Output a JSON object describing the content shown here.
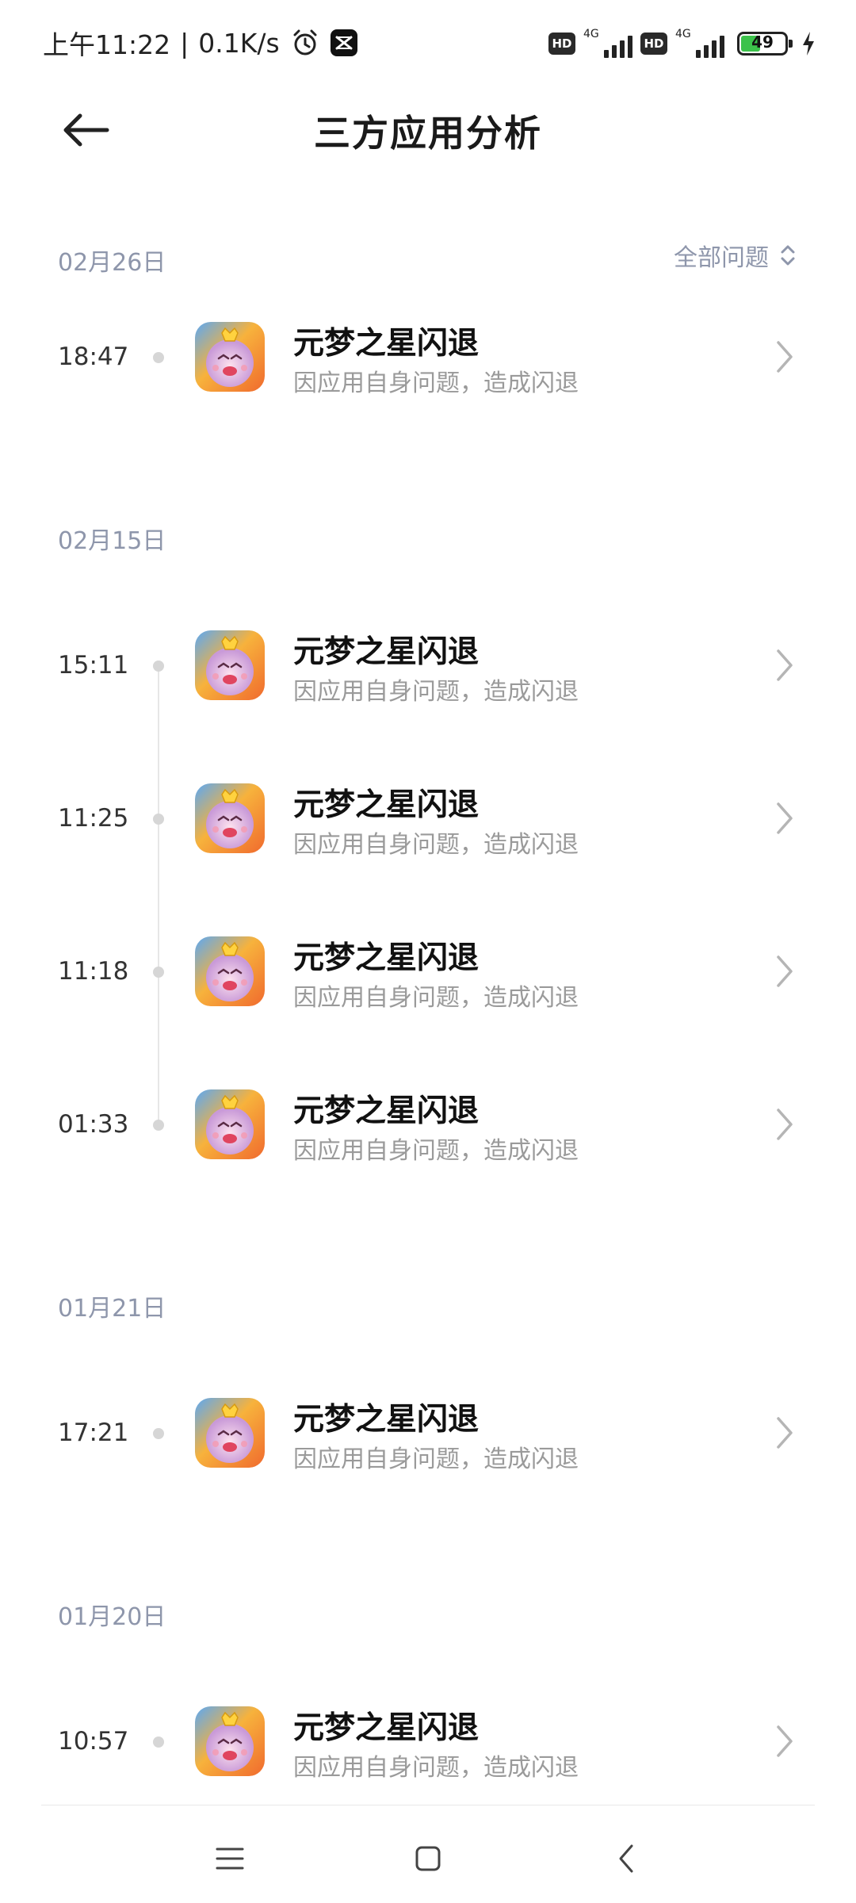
{
  "status_bar": {
    "time": "上午11:22",
    "divider": "|",
    "speed": "0.1K/s",
    "hd1": "HD",
    "net1": "4G",
    "hd2": "HD",
    "net2": "4G",
    "battery": "49",
    "battery_level_percent": 49
  },
  "header": {
    "title": "三方应用分析"
  },
  "filter": {
    "label": "全部问题"
  },
  "groups": [
    {
      "date": "02月26日",
      "entries": [
        {
          "time": "18:47",
          "title": "元梦之星闪退",
          "subtitle": "因应用自身问题，造成闪退"
        }
      ]
    },
    {
      "date": "02月15日",
      "entries": [
        {
          "time": "15:11",
          "title": "元梦之星闪退",
          "subtitle": "因应用自身问题，造成闪退"
        },
        {
          "time": "11:25",
          "title": "元梦之星闪退",
          "subtitle": "因应用自身问题，造成闪退"
        },
        {
          "time": "11:18",
          "title": "元梦之星闪退",
          "subtitle": "因应用自身问题，造成闪退"
        },
        {
          "time": "01:33",
          "title": "元梦之星闪退",
          "subtitle": "因应用自身问题，造成闪退"
        }
      ]
    },
    {
      "date": "01月21日",
      "entries": [
        {
          "time": "17:21",
          "title": "元梦之星闪退",
          "subtitle": "因应用自身问题，造成闪退"
        }
      ]
    },
    {
      "date": "01月20日",
      "entries": [
        {
          "time": "10:57",
          "title": "元梦之星闪退",
          "subtitle": "因应用自身问题，造成闪退"
        }
      ]
    }
  ],
  "icons": {
    "back": "arrow-left-icon",
    "filter": "sort-updown-icon",
    "row": "chevron-right-icon",
    "app": "yuanmeng-app-icon",
    "nav_menu": "menu-icon",
    "nav_home": "home-square-icon",
    "nav_back": "back-chevron-icon"
  },
  "colors": {
    "date_text": "#8e96ab",
    "subtitle_text": "#9a9a9a",
    "battery_fill": "#3cc24b"
  }
}
